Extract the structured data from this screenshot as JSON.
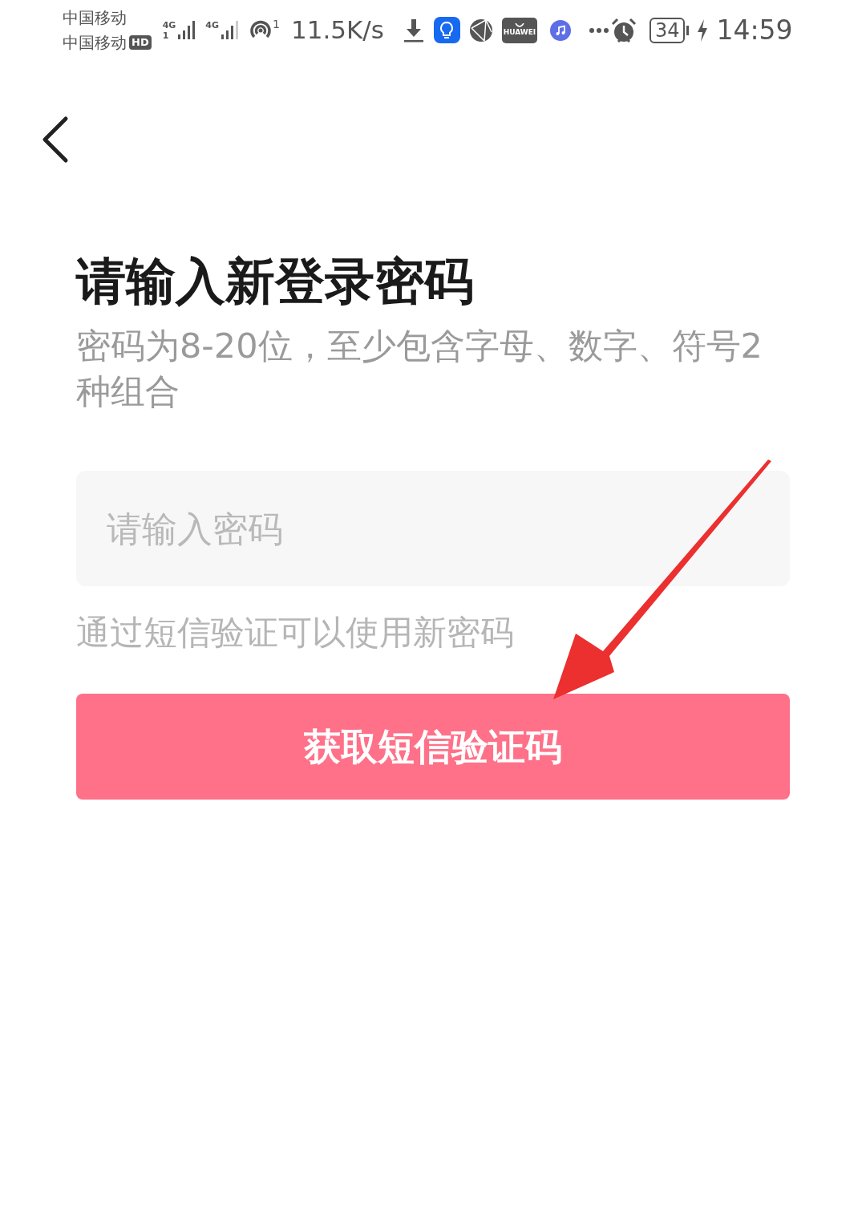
{
  "status_bar": {
    "carriers": [
      "中国移动",
      "中国移动"
    ],
    "hd_badge": "HD",
    "network_types": [
      "4G",
      "4G"
    ],
    "sim_index": "1",
    "hotspot_count": "1",
    "speed": "11.5K/s",
    "app_icon_label": "HUAWEI",
    "battery": "34",
    "time": "14:59"
  },
  "title": "请输入新登录密码",
  "description": "密码为8-20位，至少包含字母、数字、符号2种组合",
  "password_field": {
    "placeholder": "请输入密码"
  },
  "hint": "通过短信验证可以使用新密码",
  "button": {
    "label": "获取短信验证码",
    "disabled": true
  }
}
